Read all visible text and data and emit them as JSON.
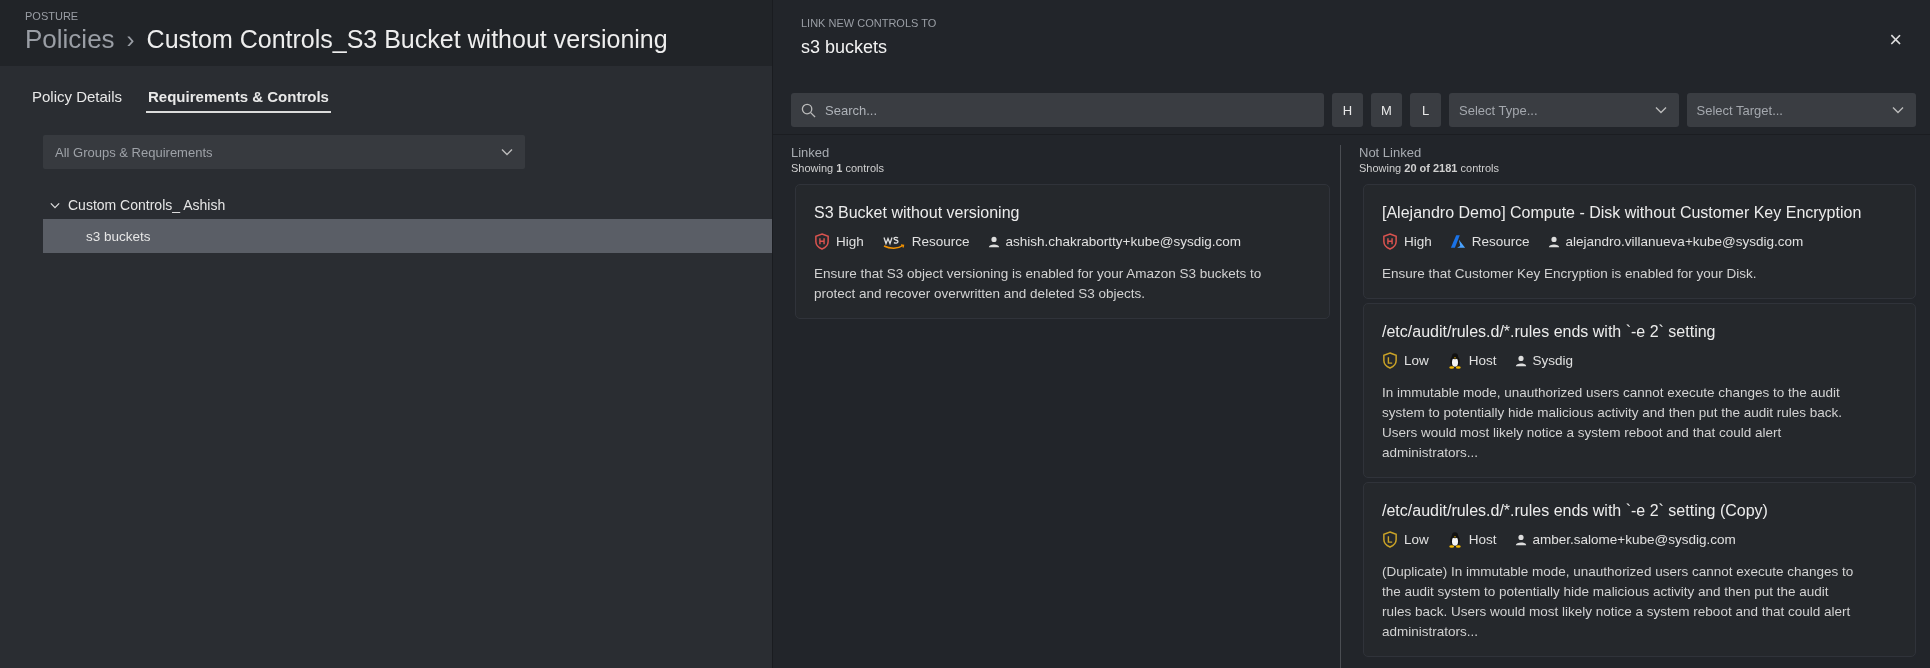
{
  "page": {
    "section": "POSTURE",
    "breadcrumb": "Policies",
    "separator": "›",
    "title": "Custom Controls_S3 Bucket without versioning"
  },
  "tabs": [
    {
      "label": "Policy Details",
      "selected": false
    },
    {
      "label": "Requirements & Controls",
      "selected": true
    }
  ],
  "group_filter": {
    "value": "All Groups & Requirements"
  },
  "tree": [
    {
      "label": "Custom Controls_ Ashish",
      "expanded": true,
      "selected": false,
      "children": [
        {
          "label": "s3 buckets",
          "selected": true
        }
      ]
    }
  ],
  "drawer": {
    "caption": "LINK NEW CONTROLS TO",
    "title": "s3 buckets",
    "close": "×",
    "search": {
      "placeholder": "Search..."
    },
    "severity_filters": [
      "H",
      "M",
      "L"
    ],
    "type_select": {
      "placeholder": "Select Type..."
    },
    "target_select": {
      "placeholder": "Select Target..."
    },
    "linked": {
      "heading": "Linked",
      "count": "Showing **1** controls",
      "controls": [
        {
          "title": "S3 Bucket without versioning",
          "severity": {
            "kind": "high",
            "label": "High"
          },
          "platform": {
            "kind": "aws",
            "label": "Resource"
          },
          "author": "ashish.chakrabortty+kube@sysdig.com",
          "description": "Ensure that S3 object versioning is enabled for your Amazon S3 buckets to protect and recover overwritten and deleted S3 objects."
        }
      ]
    },
    "not_linked": {
      "heading": "Not Linked",
      "count": "Showing **20 of 2181** controls",
      "controls": [
        {
          "title": "[Alejandro Demo] Compute - Disk without Customer Key Encryption",
          "severity": {
            "kind": "high",
            "label": "High"
          },
          "platform": {
            "kind": "azure",
            "label": "Resource"
          },
          "author": "alejandro.villanueva+kube@sysdig.com",
          "description": "Ensure that Customer Key Encryption is enabled for your Disk."
        },
        {
          "title": "/etc/audit/rules.d/*.rules ends with `-e 2` setting",
          "severity": {
            "kind": "low",
            "label": "Low"
          },
          "platform": {
            "kind": "linux",
            "label": "Host"
          },
          "author": "Sysdig",
          "description": "In immutable mode, unauthorized users cannot execute changes to the audit system to potentially hide malicious activity and then put the audit rules back. Users would most likely notice a system reboot and that could alert administrators..."
        },
        {
          "title": "/etc/audit/rules.d/*.rules ends with `-e 2` setting (Copy)",
          "severity": {
            "kind": "low",
            "label": "Low"
          },
          "platform": {
            "kind": "linux",
            "label": "Host"
          },
          "author": "amber.salome+kube@sysdig.com",
          "description": "(Duplicate) In immutable mode, unauthorized users cannot execute changes to the audit system to potentially hide malicious activity and then put the audit rules back. Users would most likely notice a system reboot and that could alert administrators..."
        }
      ]
    }
  }
}
